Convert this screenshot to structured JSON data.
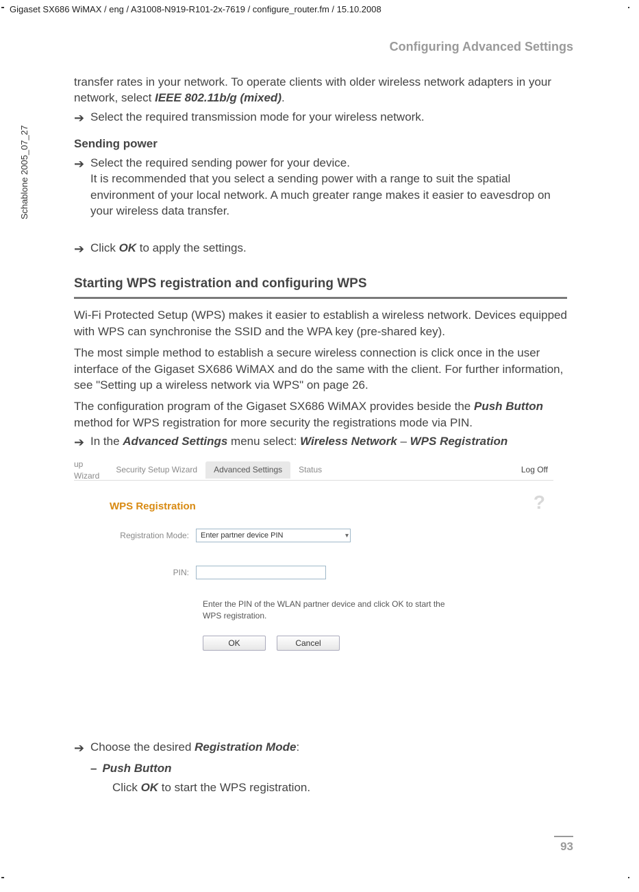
{
  "doc": {
    "header_path": "Gigaset SX686 WiMAX / eng / A31008-N919-R101-2x-7619 / configure_router.fm / 15.10.2008",
    "side_label": "Schablone 2005_07_27",
    "page_title": "Configuring Advanced Settings",
    "page_number": "93"
  },
  "body": {
    "intro1a": "transfer rates in your network. To operate clients with older wireless network adapters in your network, select ",
    "intro1b": "IEEE 802.11b/g (mixed)",
    "intro1c": ".",
    "arrow1": "Select the required transmission mode for your wireless network.",
    "sending_power_h": "Sending power",
    "arrow2a": "Select the required sending power for your device.",
    "arrow2b": "It is recommended that you select a sending power with a range to suit the spatial environment of your local network. A much greater range makes it easier to eavesdrop on your wireless data transfer.",
    "arrow3a": "Click ",
    "arrow3b": "OK",
    "arrow3c": " to apply the settings.",
    "h2": "Starting WPS registration and configuring WPS",
    "p1": "Wi-Fi Protected Setup (WPS) makes it easier to establish a wireless network. Devices equipped with WPS can synchronise the SSID and the WPA key (pre-shared key).",
    "p2": "The most simple method to establish a secure wireless connection is click once in the user interface of the Gigaset SX686 WiMAX and do the same with the client. For further information, see \"Setting up a wireless network via WPS\" on page 26.",
    "p3a": "The configuration program of the Gigaset SX686 WiMAX provides beside the ",
    "p3b": "Push Button",
    "p3c": " method for WPS registration for more security the registrations mode via PIN.",
    "arrow4a": "In the ",
    "arrow4b": "Advanced Settings",
    "arrow4c": " menu select: ",
    "arrow4d": "Wireless Network",
    "arrow4e": " – ",
    "arrow4f": "WPS Registration",
    "after1a": "Choose the desired ",
    "after1b": "Registration Mode",
    "after1c": ":",
    "dash1": "Push Button",
    "dash1sub_a": "Click ",
    "dash1sub_b": "OK",
    "dash1sub_c": " to start the WPS registration."
  },
  "shot": {
    "tabs": {
      "t0": "up Wizard",
      "t1": "Security Setup Wizard",
      "t2": "Advanced Settings",
      "t3": "Status",
      "logoff": "Log Off"
    },
    "title": "WPS Registration",
    "help": "?",
    "label_mode": "Registration Mode:",
    "mode_value": "Enter partner device PIN",
    "label_pin": "PIN:",
    "pin_value": "",
    "hint": "Enter the PIN of the WLAN partner device and click OK to start the WPS registration.",
    "btn_ok": "OK",
    "btn_cancel": "Cancel"
  }
}
